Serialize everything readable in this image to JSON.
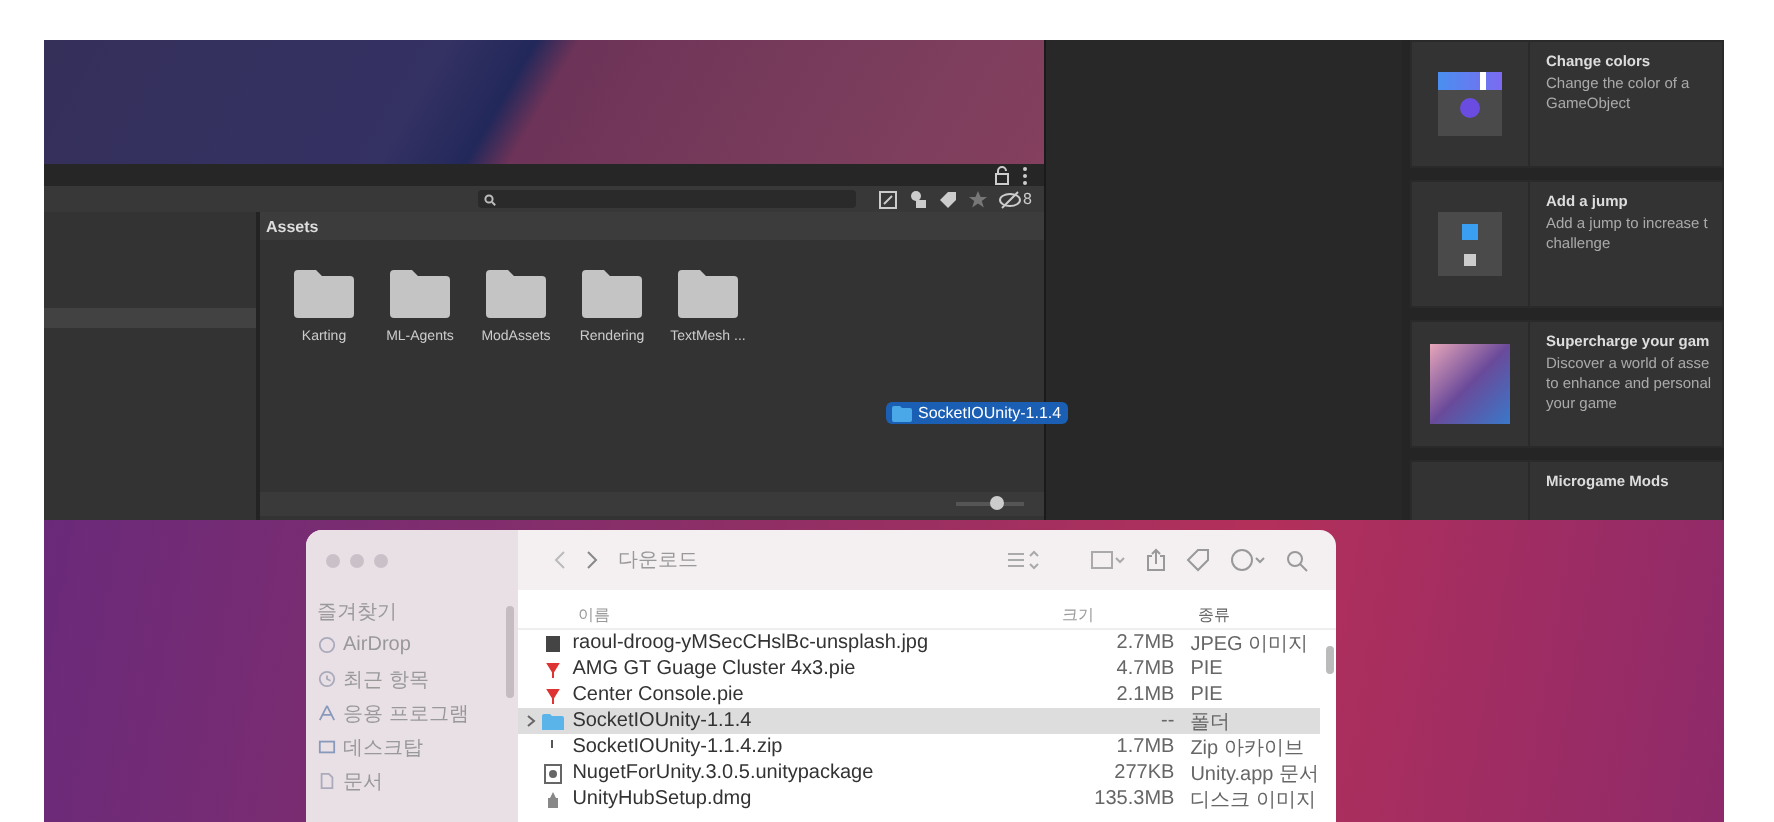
{
  "unity": {
    "project": {
      "title": "Assets",
      "hidden_count": "8",
      "folders": [
        {
          "name": "Karting"
        },
        {
          "name": "ML-Agents"
        },
        {
          "name": "ModAssets"
        },
        {
          "name": "Rendering"
        },
        {
          "name": "TextMesh ..."
        }
      ],
      "zoom_slider": {
        "level": 0.6
      }
    },
    "dragged_item": {
      "name": "SocketIOUnity-1.1.4"
    },
    "tutorials": [
      {
        "kind": "color",
        "title": "Change colors",
        "lines": [
          "Change the color of a",
          "GameObject"
        ]
      },
      {
        "kind": "jump",
        "title": "Add a jump",
        "lines": [
          "Add a jump to increase t",
          "challenge"
        ]
      },
      {
        "kind": "photo",
        "title": "Supercharge your gam",
        "lines": [
          "Discover a world of asse",
          "to enhance and personal",
          "your game"
        ]
      },
      {
        "kind": "blank",
        "title": "Microgame Mods"
      }
    ]
  },
  "finder": {
    "title": "다운로드",
    "sidebar": {
      "heading": "즐겨찾기",
      "items": [
        {
          "kind": "airdrop",
          "label": "AirDrop"
        },
        {
          "kind": "recent",
          "label": "최근 항목"
        },
        {
          "kind": "apps",
          "label": "응용 프로그램"
        },
        {
          "kind": "desktop",
          "label": "데스크탑"
        },
        {
          "kind": "docs",
          "label": "문서"
        }
      ]
    },
    "columns": [
      "이름",
      "크기",
      "종류"
    ],
    "rows": [
      {
        "kind": "image",
        "name": "raoul-droog-yMSecCHslBc-unsplash.jpg",
        "size": "2.7MB",
        "type": "JPEG 이미지",
        "selected": false,
        "expandable": false
      },
      {
        "kind": "pie",
        "name": "AMG GT Guage Cluster 4x3.pie",
        "size": "4.7MB",
        "type": "PIE",
        "selected": false,
        "expandable": false
      },
      {
        "kind": "pie",
        "name": "Center Console.pie",
        "size": "2.1MB",
        "type": "PIE",
        "selected": false,
        "expandable": false
      },
      {
        "kind": "folder",
        "name": "SocketIOUnity-1.1.4",
        "size": "--",
        "type": "폴더",
        "selected": true,
        "expandable": true
      },
      {
        "kind": "zip",
        "name": "SocketIOUnity-1.1.4.zip",
        "size": "1.7MB",
        "type": "Zip 아카이브",
        "selected": false,
        "expandable": false
      },
      {
        "kind": "package",
        "name": "NugetForUnity.3.0.5.unitypackage",
        "size": "277KB",
        "type": "Unity.app 문서",
        "selected": false,
        "expandable": false
      },
      {
        "kind": "disk",
        "name": "UnityHubSetup.dmg",
        "size": "135.3MB",
        "type": "디스크 이미지",
        "selected": false,
        "expandable": false
      }
    ]
  }
}
